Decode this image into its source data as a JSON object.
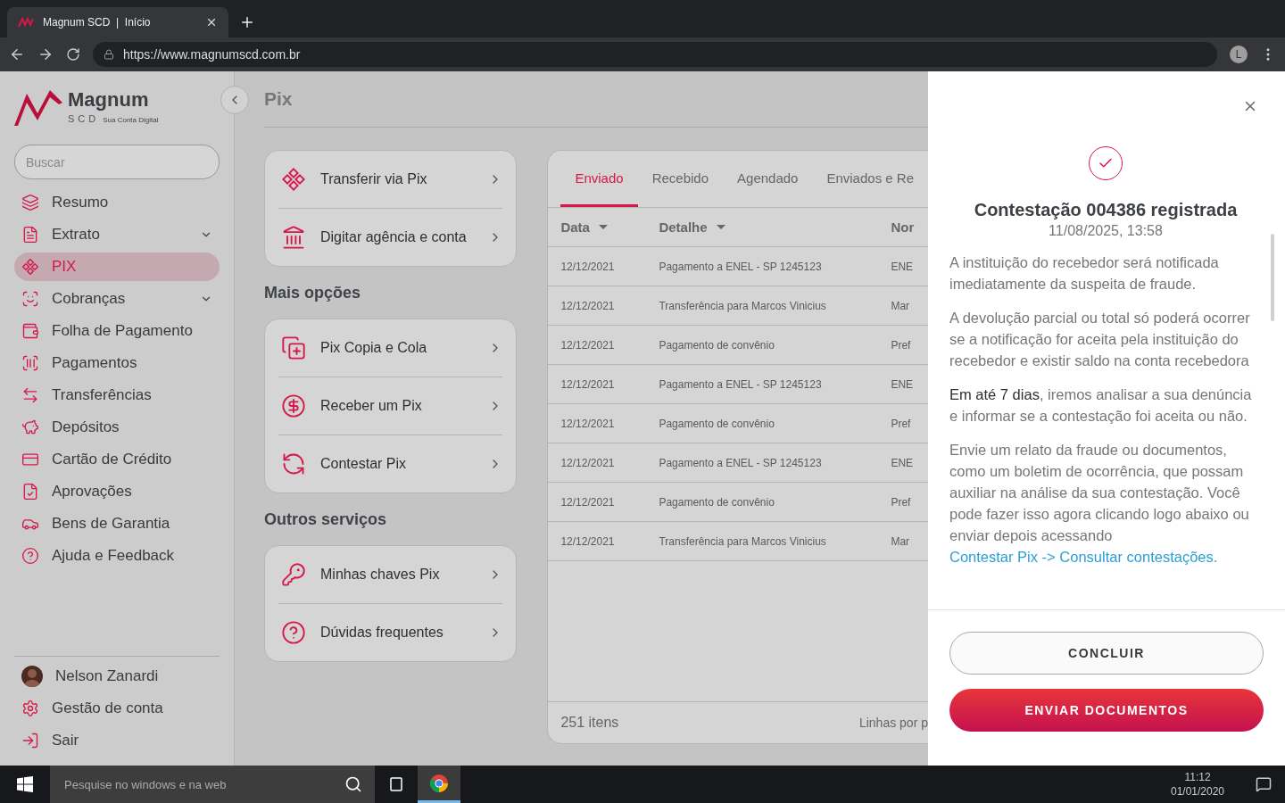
{
  "browser": {
    "tab_title": "Magnum SCD  |  Início",
    "url": "https://www.magnumscd.com.br",
    "profile_initial": "L"
  },
  "sidebar": {
    "logo": {
      "name": "Magnum",
      "sub": "SCD",
      "tagline": "Sua Conta Digital"
    },
    "search": {
      "placeholder": "Buscar"
    },
    "items": [
      {
        "label": "Resumo",
        "selected": false,
        "expandable": false
      },
      {
        "label": "Extrato",
        "selected": false,
        "expandable": true
      },
      {
        "label": "PIX",
        "selected": true,
        "expandable": false
      },
      {
        "label": "Cobranças",
        "selected": false,
        "expandable": true
      },
      {
        "label": "Folha de Pagamento",
        "selected": false,
        "expandable": false
      },
      {
        "label": "Pagamentos",
        "selected": false,
        "expandable": false
      },
      {
        "label": "Transferências",
        "selected": false,
        "expandable": false
      },
      {
        "label": "Depósitos",
        "selected": false,
        "expandable": false
      },
      {
        "label": "Cartão de Crédito",
        "selected": false,
        "expandable": false
      },
      {
        "label": "Aprovações",
        "selected": false,
        "expandable": false
      },
      {
        "label": "Bens de Garantia",
        "selected": false,
        "expandable": false
      },
      {
        "label": "Ajuda e Feedback",
        "selected": false,
        "expandable": false
      }
    ],
    "user": {
      "name": "Nelson Zanardi"
    },
    "footer_items": [
      "Gestão de conta",
      "Sair"
    ]
  },
  "page": {
    "title": "Pix",
    "action_groups": [
      {
        "items": [
          "Transferir via Pix",
          "Digitar agência e conta"
        ]
      },
      {
        "heading": "Mais opções",
        "items": [
          "Pix Copia e Cola",
          "Receber um Pix",
          "Contestar Pix"
        ]
      },
      {
        "heading": "Outros serviços",
        "items": [
          "Minhas chaves Pix",
          "Dúvidas frequentes"
        ]
      }
    ],
    "table": {
      "tabs": [
        {
          "label": "Enviado",
          "selected": true
        },
        {
          "label": "Recebido",
          "selected": false
        },
        {
          "label": "Agendado",
          "selected": false
        },
        {
          "label": "Enviados e Re",
          "selected": false
        }
      ],
      "columns": [
        "Data",
        "Detalhe",
        "Nor"
      ],
      "rows": [
        [
          "12/12/2021",
          "Pagamento a ENEL - SP 1245123",
          "ENE"
        ],
        [
          "12/12/2021",
          "Transferência para Marcos Vinicius",
          "Mar"
        ],
        [
          "12/12/2021",
          "Pagamento de convênio",
          "Pref"
        ],
        [
          "12/12/2021",
          "Pagamento a ENEL - SP 1245123",
          "ENE"
        ],
        [
          "12/12/2021",
          "Pagamento de convênio",
          "Pref"
        ],
        [
          "12/12/2021",
          "Pagamento a ENEL - SP 1245123",
          "ENE"
        ],
        [
          "12/12/2021",
          "Pagamento de convênio",
          "Pref"
        ],
        [
          "12/12/2021",
          "Transferência para Marcos Vinicius",
          "Mar"
        ]
      ],
      "footer": {
        "count": "251 itens",
        "rows_per_page": "Linhas por p"
      }
    }
  },
  "drawer": {
    "title": "Contestação 004386 registrada",
    "date": "11/08/2025, 13:58",
    "paragraphs": [
      {
        "text": "A instituição do recebedor será notificada imediatamente da suspeita de fraude."
      },
      {
        "text": "A devolução parcial ou total só poderá ocorrer se a notificação for aceita pela instituição do recebedor e existir saldo na conta recebedora"
      },
      {
        "text": "**Em até 7 dias**, iremos analisar a sua denúncia e informar se a contestação foi aceita ou não."
      },
      {
        "text": "Envie um relato da fraude ou documentos, como um boletim de ocorrência, que possam auxiliar na análise da sua contestação. Você pode fazer isso agora clicando logo abaixo ou enviar depois acessando",
        "link": "Contestar Pix -> Consultar contestações."
      }
    ],
    "buttons": [
      {
        "label": "CONCLUIR",
        "kind": "secondary"
      },
      {
        "label": "ENVIAR DOCUMENTOS",
        "kind": "primary"
      }
    ]
  },
  "taskbar": {
    "search_placeholder": "Pesquise no windows e na web",
    "time": "11:12",
    "date": "01/01/2020"
  }
}
